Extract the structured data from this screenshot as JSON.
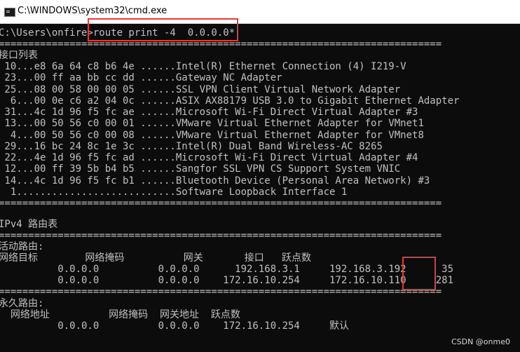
{
  "window": {
    "title": "C:\\WINDOWS\\system32\\cmd.exe",
    "icon": "cmd-icon"
  },
  "console": {
    "prompt_path": "C:\\Users\\onfire",
    "prompt_symbol": ">",
    "command": "route print -4  0.0.0.0*",
    "separator": "===========================================================================",
    "interface_list_title": "接口列表",
    "interfaces": [
      {
        "idx": " 10",
        "mac": "e8 6a 64 c8 b6 4e",
        "desc": "Intel(R) Ethernet Connection (4) I219-V"
      },
      {
        "idx": " 23",
        "mac": "00 ff aa bb cc dd",
        "desc": "Gateway NC Adapter"
      },
      {
        "idx": " 25",
        "mac": "08 00 58 00 00 05",
        "desc": "SSL VPN Client Virtual Network Adapter"
      },
      {
        "idx": "  6",
        "mac": "00 0e c6 a2 04 0c",
        "desc": "ASIX AX88179 USB 3.0 to Gigabit Ethernet Adapter"
      },
      {
        "idx": " 31",
        "mac": "4c 1d 96 f5 fc ae",
        "desc": "Microsoft Wi-Fi Direct Virtual Adapter #3"
      },
      {
        "idx": " 13",
        "mac": "00 50 56 c0 00 01",
        "desc": "VMware Virtual Ethernet Adapter for VMnet1"
      },
      {
        "idx": "  4",
        "mac": "00 50 56 c0 00 08",
        "desc": "VMware Virtual Ethernet Adapter for VMnet8"
      },
      {
        "idx": " 29",
        "mac": "16 bc 24 8c 1e 3c",
        "desc": "Intel(R) Dual Band Wireless-AC 8265"
      },
      {
        "idx": " 22",
        "mac": "4e 1d 96 f5 fc ad",
        "desc": "Microsoft Wi-Fi Direct Virtual Adapter #4"
      },
      {
        "idx": " 12",
        "mac": "00 ff 39 5b b4 b5",
        "desc": "Sangfor SSL VPN CS Support System VNIC"
      },
      {
        "idx": " 14",
        "mac": "4c 1d 96 f5 fc b1",
        "desc": "Bluetooth Device (Personal Area Network) #3"
      },
      {
        "idx": "  1",
        "mac": "",
        "desc": "Software Loopback Interface 1"
      }
    ],
    "ipv4_title": "IPv4 路由表",
    "active_routes_title": "活动路由:",
    "active_routes_header": "网络目标        网络掩码          网关       接口   跃点数",
    "active_routes": [
      {
        "dest": "0.0.0.0",
        "mask": "0.0.0.0",
        "gateway": "192.168.3.1",
        "iface": "192.168.3.192",
        "metric": "35"
      },
      {
        "dest": "0.0.0.0",
        "mask": "0.0.0.0",
        "gateway": "172.16.10.254",
        "iface": "172.16.10.110",
        "metric": "281"
      }
    ],
    "persistent_routes_title": "永久路由:",
    "persistent_routes_header": "  网络地址          网络掩码  网关地址  跃点数",
    "persistent_routes": [
      {
        "addr": "0.0.0.0",
        "mask": "0.0.0.0",
        "gateway": "172.16.10.254",
        "metric": "默认"
      }
    ]
  },
  "watermark": "CSDN @onme0",
  "colors": {
    "console_bg": "#0c0c0c",
    "console_text": "#c0c0c0",
    "highlight": "#e53935"
  }
}
